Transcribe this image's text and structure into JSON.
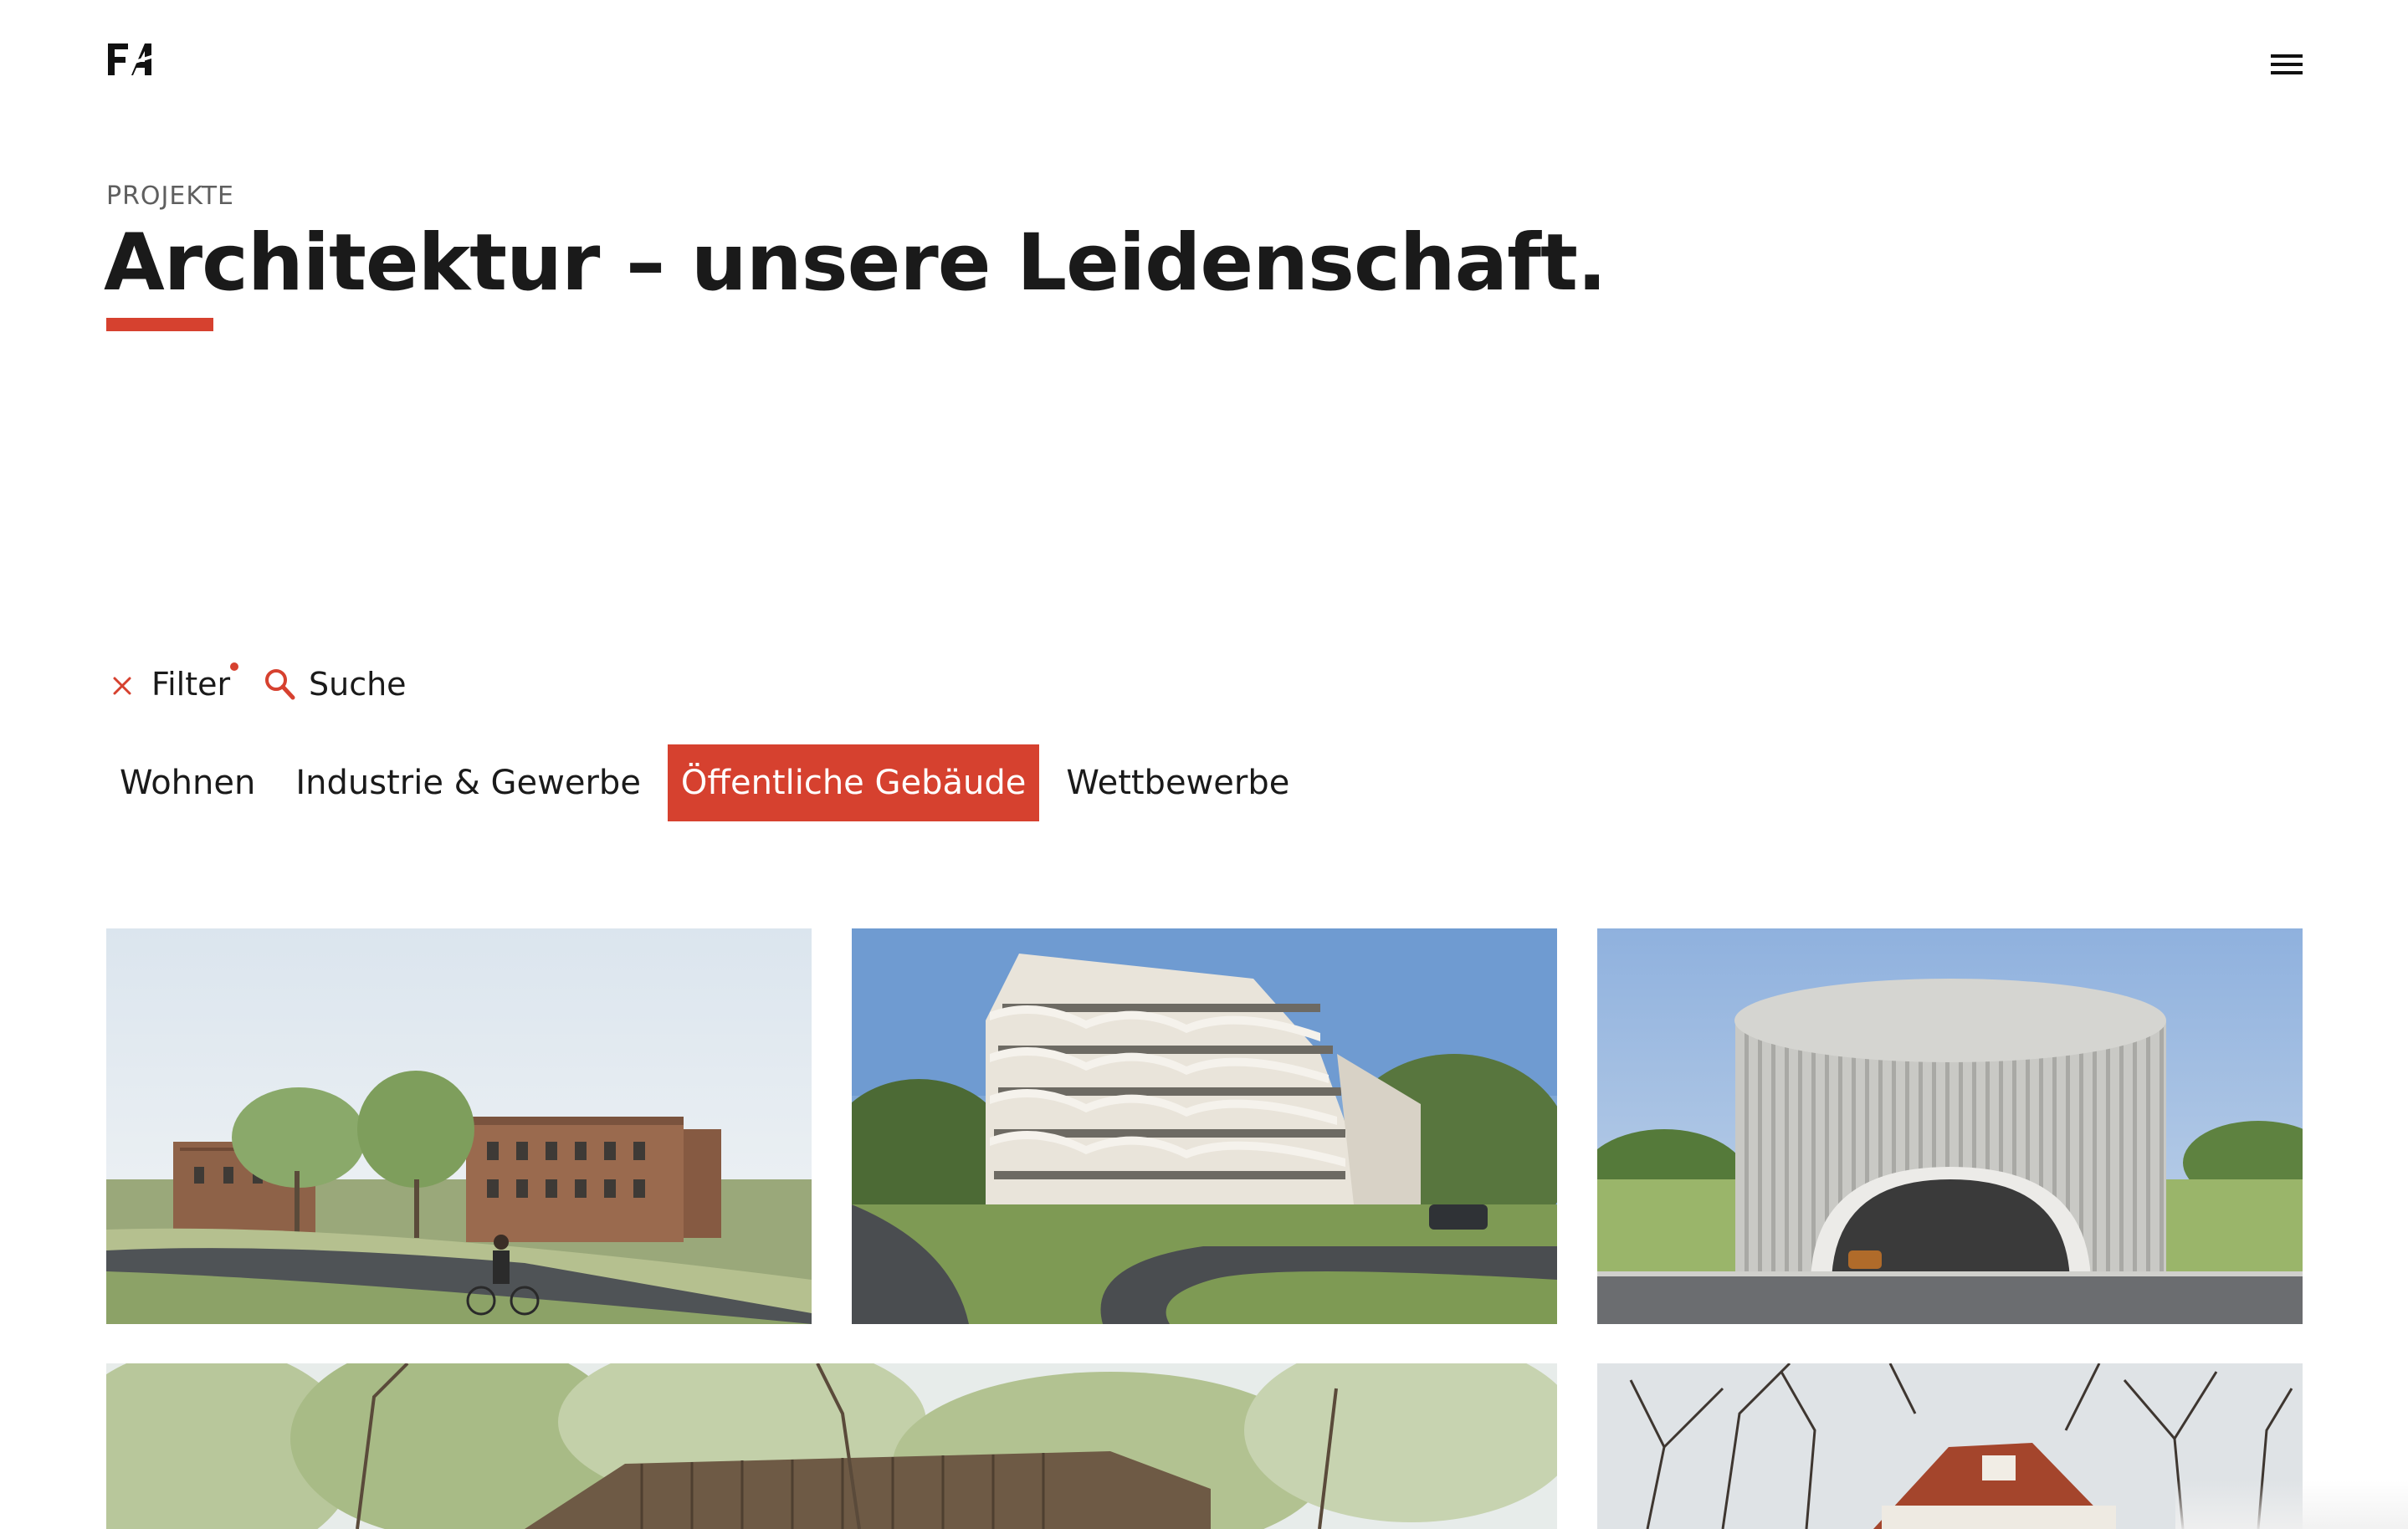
{
  "brand": {
    "logo_text": "FA",
    "logo_icon": "fa-logo-icon"
  },
  "header": {
    "menu_icon": "hamburger-menu-icon"
  },
  "hero": {
    "eyebrow": "PROJEKTE",
    "title": "Architektur – unsere Leidenschaft."
  },
  "toolbar": {
    "filter_label": "Filter",
    "filter_icon": "close-icon",
    "filter_active": true,
    "search_label": "Suche",
    "search_icon": "search-icon"
  },
  "tabs": [
    {
      "label": "Wohnen",
      "active": false
    },
    {
      "label": "Industrie & Gewerbe",
      "active": false
    },
    {
      "label": "Öffentliche Gebäude",
      "active": true
    },
    {
      "label": "Wettbewerbe",
      "active": false
    }
  ],
  "projects": [
    {
      "image": "brick-apartment-block-cyclist-photo"
    },
    {
      "image": "white-terraced-apartment-tower-photo"
    },
    {
      "image": "round-parking-garage-photo"
    },
    {
      "image": "timber-hall-among-trees-photo"
    },
    {
      "image": "red-roof-house-bare-trees-photo"
    }
  ],
  "colors": {
    "accent": "#d6412f",
    "text": "#1a1a1a",
    "muted": "#5f5f5f",
    "background": "#ffffff"
  }
}
